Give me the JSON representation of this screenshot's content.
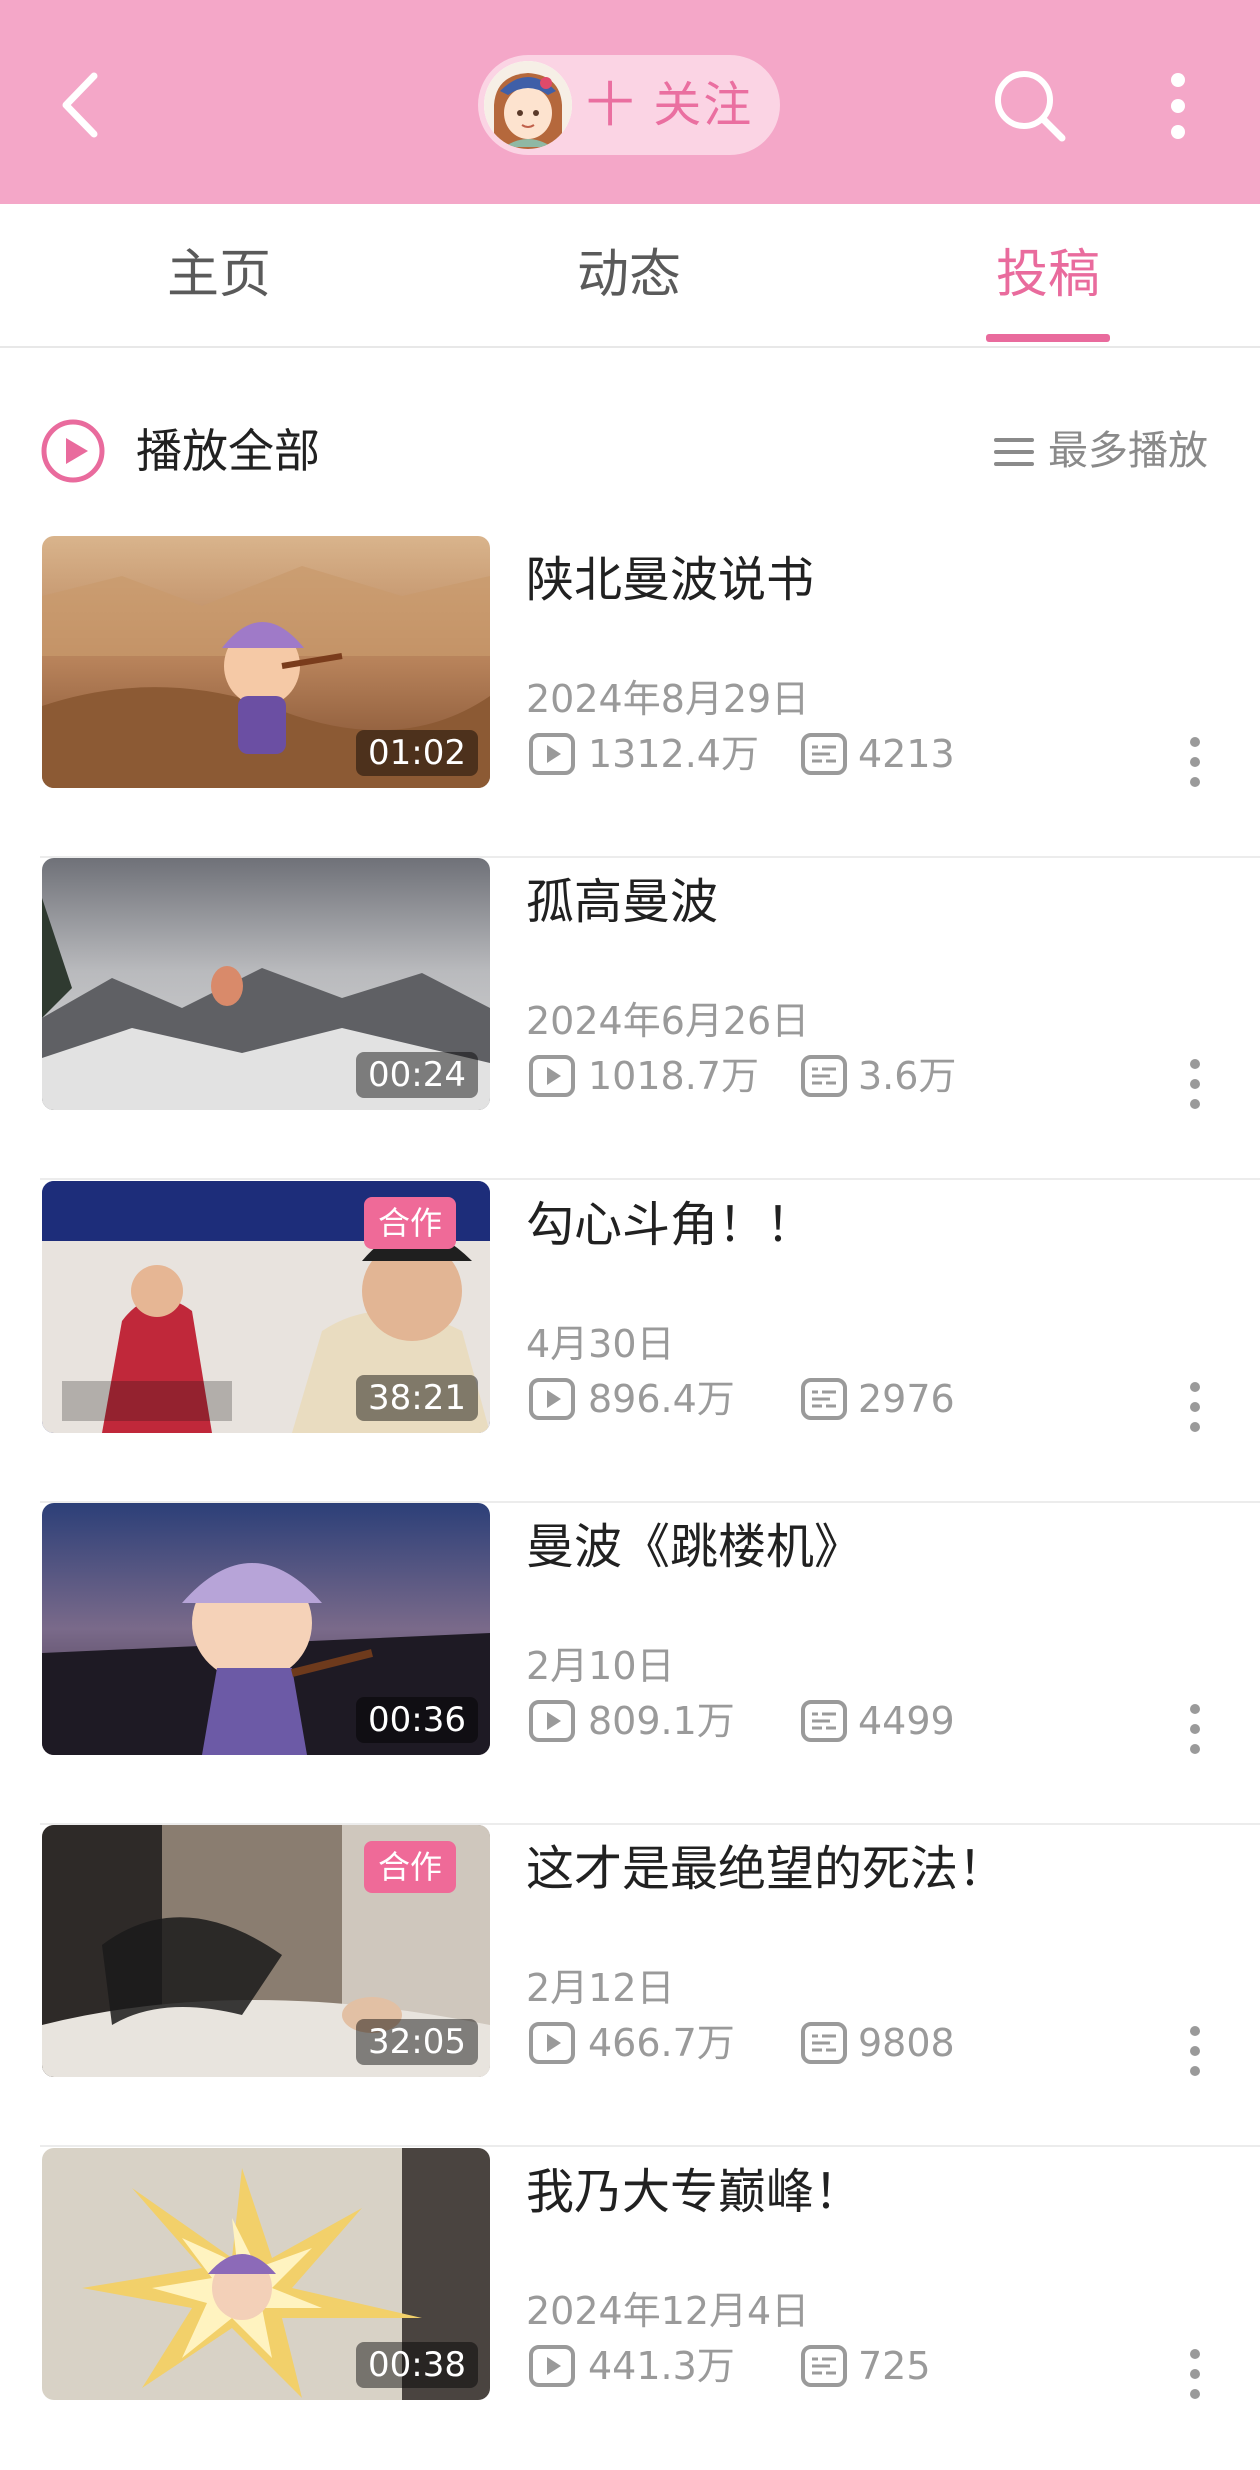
{
  "header": {
    "follow_label": "十 关注",
    "colors": {
      "bar": "#f4a7c8",
      "accent": "#e96b9d"
    }
  },
  "tabs": [
    {
      "label": "主页"
    },
    {
      "label": "动态"
    },
    {
      "label": "投稿",
      "active": true
    }
  ],
  "toolbar": {
    "play_all_label": "播放全部",
    "sort_label": "最多播放"
  },
  "videos": [
    {
      "title": "陕北曼波说书",
      "date": "2024年8月29日",
      "plays": "1312.4万",
      "danmaku": "4213",
      "duration": "01:02",
      "badge": ""
    },
    {
      "title": "孤高曼波",
      "date": "2024年6月26日",
      "plays": "1018.7万",
      "danmaku": "3.6万",
      "duration": "00:24",
      "badge": ""
    },
    {
      "title": "勾心斗角！！",
      "date": "4月30日",
      "plays": "896.4万",
      "danmaku": "2976",
      "duration": "38:21",
      "badge": "合作"
    },
    {
      "title": "曼波《跳楼机》",
      "date": "2月10日",
      "plays": "809.1万",
      "danmaku": "4499",
      "duration": "00:36",
      "badge": ""
    },
    {
      "title": "这才是最绝望的死法！",
      "date": "2月12日",
      "plays": "466.7万",
      "danmaku": "9808",
      "duration": "32:05",
      "badge": "合作"
    },
    {
      "title": "我乃大专巅峰！",
      "date": "2024年12月4日",
      "plays": "441.3万",
      "danmaku": "725",
      "duration": "00:38",
      "badge": ""
    }
  ]
}
